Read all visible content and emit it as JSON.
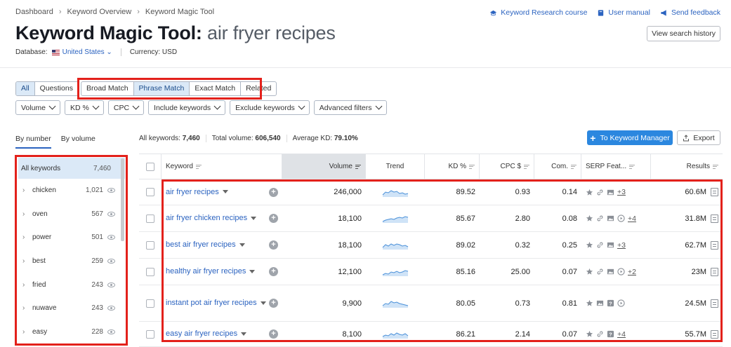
{
  "breadcrumb": [
    "Dashboard",
    "Keyword Overview",
    "Keyword Magic Tool"
  ],
  "top_links": [
    {
      "icon": "graduation-cap-icon",
      "label": "Keyword Research course"
    },
    {
      "icon": "book-icon",
      "label": "User manual"
    },
    {
      "icon": "megaphone-icon",
      "label": "Send feedback"
    }
  ],
  "title": {
    "tool": "Keyword Magic Tool:",
    "keyword": "air fryer recipes"
  },
  "view_history_label": "View search history",
  "database": {
    "label": "Database:",
    "value": "United States",
    "currency": "Currency: USD"
  },
  "segment_main": [
    "All",
    "Questions"
  ],
  "segment_match": [
    "Broad Match",
    "Phrase Match",
    "Exact Match",
    "Related"
  ],
  "filters": [
    "Volume",
    "KD %",
    "CPC",
    "Include keywords",
    "Exclude keywords",
    "Advanced filters"
  ],
  "sidebar_tabs": [
    "By number",
    "By volume"
  ],
  "sidebar": {
    "all": {
      "label": "All keywords",
      "count": "7,460"
    },
    "groups": [
      {
        "label": "chicken",
        "count": "1,021"
      },
      {
        "label": "oven",
        "count": "567"
      },
      {
        "label": "power",
        "count": "501"
      },
      {
        "label": "best",
        "count": "259"
      },
      {
        "label": "fried",
        "count": "243"
      },
      {
        "label": "nuwave",
        "count": "243"
      },
      {
        "label": "easy",
        "count": "228"
      }
    ]
  },
  "stats": {
    "all_label": "All keywords:",
    "all_value": "7,460",
    "vol_label": "Total volume:",
    "vol_value": "606,540",
    "kd_label": "Average KD:",
    "kd_value": "79.10%"
  },
  "to_km_label": "To Keyword Manager",
  "export_label": "Export",
  "columns": [
    "Keyword",
    "Volume",
    "Trend",
    "KD %",
    "CPC $",
    "Com.",
    "SERP Feat...",
    "Results"
  ],
  "rows": [
    {
      "kw": "air fryer recipes",
      "vol": "246,000",
      "kd": "89.52",
      "cpc": "0.93",
      "com": "0.14",
      "serp_more": "+3",
      "res": "60.6M"
    },
    {
      "kw": "air fryer chicken recipes",
      "vol": "18,100",
      "kd": "85.67",
      "cpc": "2.80",
      "com": "0.08",
      "serp_more": "+4",
      "res": "31.8M"
    },
    {
      "kw": "best air fryer recipes",
      "vol": "18,100",
      "kd": "89.02",
      "cpc": "0.32",
      "com": "0.25",
      "serp_more": "+3",
      "res": "62.7M"
    },
    {
      "kw": "healthy air fryer recipes",
      "vol": "12,100",
      "kd": "85.16",
      "cpc": "25.00",
      "com": "0.07",
      "serp_more": "+2",
      "res": "23M"
    },
    {
      "kw": "instant pot air fryer recipes",
      "vol": "9,900",
      "kd": "80.05",
      "cpc": "0.73",
      "com": "0.81",
      "serp_more": "",
      "res": "24.5M"
    },
    {
      "kw": "easy air fryer recipes",
      "vol": "8,100",
      "kd": "86.21",
      "cpc": "2.14",
      "com": "0.07",
      "serp_more": "+4",
      "res": "55.7M"
    }
  ],
  "colors": {
    "accent": "#2b63c0",
    "highlight": "#e3211b",
    "primary_button": "#2b87df"
  }
}
